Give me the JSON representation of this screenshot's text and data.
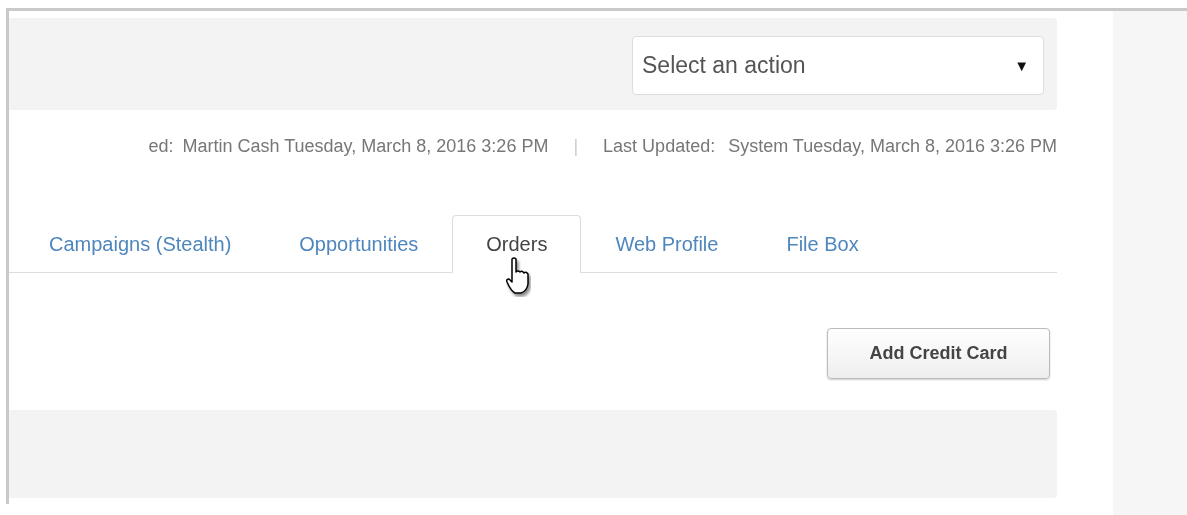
{
  "action_select": {
    "value": "Select an action",
    "caret": "▼"
  },
  "meta": [
    {
      "kind": "value",
      "text": "ed:"
    },
    {
      "kind": "value",
      "text": "Martin Cash Tuesday, March 8, 2016 3:26 PM"
    },
    {
      "kind": "separator",
      "text": "|"
    },
    {
      "kind": "label",
      "text": "Last Updated:"
    },
    {
      "kind": "value",
      "text": "System Tuesday, March 8, 2016 3:26 PM"
    }
  ],
  "tabs": [
    {
      "label": "Campaigns (Stealth)",
      "selected": false
    },
    {
      "label": "Opportunities",
      "selected": false
    },
    {
      "label": "Orders",
      "selected": true
    },
    {
      "label": "Web Profile",
      "selected": false
    },
    {
      "label": "File Box",
      "selected": false
    }
  ],
  "buttons": [
    "Add Credit Card"
  ]
}
